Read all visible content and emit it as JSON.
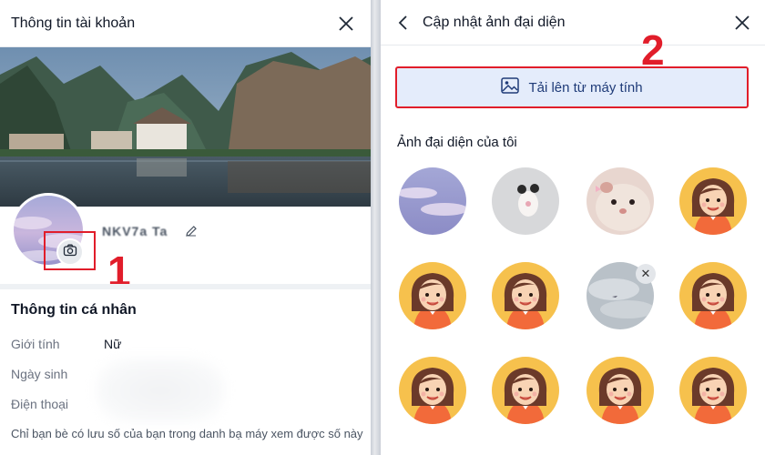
{
  "left_panel": {
    "title": "Thông tin tài khoản",
    "profile_name": "NKV7a Ta",
    "section_title": "Thông tin cá nhân",
    "fields": [
      {
        "label": "Giới tính",
        "value": "Nữ"
      },
      {
        "label": "Ngày sinh",
        "value": ""
      },
      {
        "label": "Điện thoại",
        "value": ""
      }
    ],
    "note": "Chỉ bạn bè có lưu số của bạn trong danh bạ máy xem được số này"
  },
  "right_panel": {
    "title": "Cập nhật ảnh đại diện",
    "upload_label": "Tải lên từ máy tính",
    "my_avatars_title": "Ảnh đại diện của tôi",
    "avatars": [
      "sky",
      "plush",
      "hamster",
      "girl",
      "girl",
      "girl",
      "sky-grey",
      "girl",
      "girl",
      "girl",
      "girl",
      "girl"
    ]
  },
  "annotations": {
    "step1": "1",
    "step2": "2"
  },
  "colors": {
    "highlight": "#e11d2a",
    "upload_bg": "#e4ecfb",
    "upload_text": "#1f3b78"
  },
  "icons": [
    "close-icon",
    "camera-icon",
    "edit-icon",
    "back-icon",
    "image-icon"
  ]
}
